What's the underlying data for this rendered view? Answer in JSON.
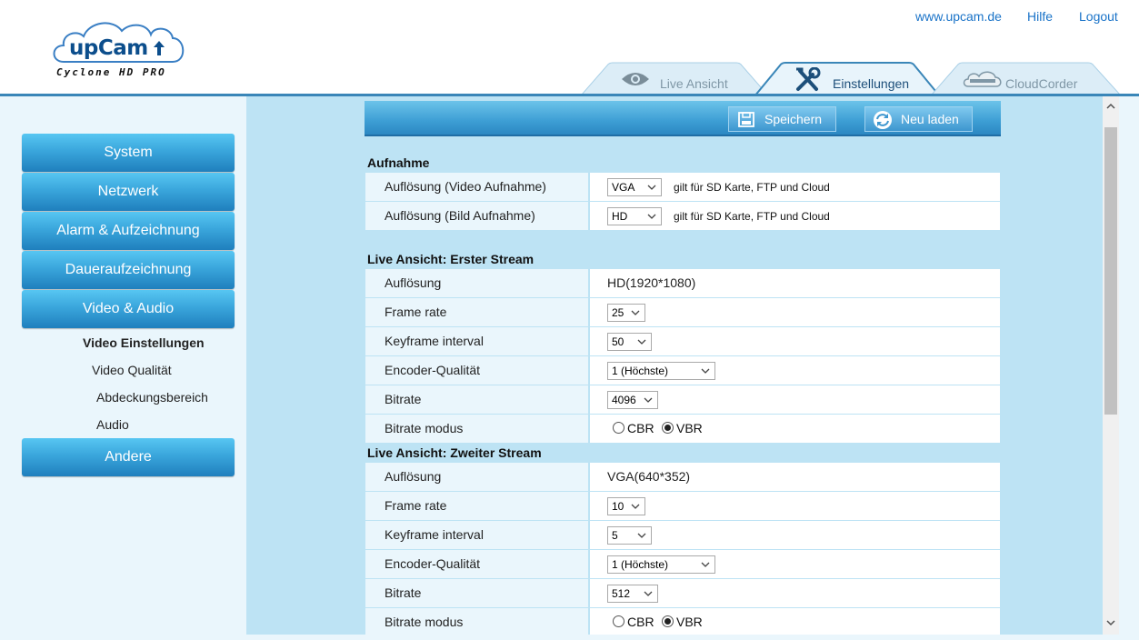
{
  "brand": {
    "logo_word": "upCam",
    "logo_sub": "Cyclone HD PRO",
    "colors": {
      "header_line": "#3a86b8",
      "menu_blue": "#2f94d0",
      "main_bg": "#bde3f4",
      "sidebar_bg": "#eaf6fc",
      "link": "#1a73c8"
    }
  },
  "top_links": {
    "website": "www.upcam.de",
    "help": "Hilfe",
    "logout": "Logout"
  },
  "tabs": [
    {
      "label": "Live Ansicht",
      "icon": "eye-icon",
      "active": false
    },
    {
      "label": "Einstellungen",
      "icon": "tools-icon",
      "active": true
    },
    {
      "label": "CloudCorder",
      "icon": "cloudcorder-icon",
      "active": false
    }
  ],
  "sidebar": {
    "menu": [
      "System",
      "Netzwerk",
      "Alarm & Aufzeichnung",
      "Daueraufzeichnung",
      "Video & Audio"
    ],
    "submenu": [
      {
        "label": "Video Einstellungen",
        "active": true
      },
      {
        "label": "Video Qualität",
        "active": false
      },
      {
        "label": "Abdeckungsbereich",
        "active": false
      },
      {
        "label": "Audio",
        "active": false
      }
    ],
    "other": "Andere"
  },
  "toolbar": {
    "save_label": "Speichern",
    "reload_label": "Neu laden"
  },
  "sections": {
    "recording": {
      "title": "Aufnahme",
      "rows": [
        {
          "label": "Auflösung (Video Aufnahme)",
          "value": "VGA",
          "note": "gilt für SD Karte, FTP und Cloud"
        },
        {
          "label": "Auflösung (Bild Aufnahme)",
          "value": "HD",
          "note": "gilt für SD Karte, FTP und Cloud"
        }
      ]
    },
    "stream1": {
      "title": "Live Ansicht: Erster Stream",
      "resolution_label": "Auflösung",
      "resolution_value": "HD(1920*1080)",
      "framerate_label": "Frame rate",
      "framerate_value": "25",
      "keyframe_label": "Keyframe interval",
      "keyframe_value": "50",
      "quality_label": "Encoder-Qualität",
      "quality_value": "1 (Höchste)",
      "bitrate_label": "Bitrate",
      "bitrate_value": "4096",
      "mode_label": "Bitrate modus",
      "mode_cbr": "CBR",
      "mode_vbr": "VBR",
      "mode_selected": "VBR"
    },
    "stream2": {
      "title": "Live Ansicht: Zweiter Stream",
      "resolution_label": "Auflösung",
      "resolution_value": "VGA(640*352)",
      "framerate_label": "Frame rate",
      "framerate_value": "10",
      "keyframe_label": "Keyframe interval",
      "keyframe_value": "5",
      "quality_label": "Encoder-Qualität",
      "quality_value": "1 (Höchste)",
      "bitrate_label": "Bitrate",
      "bitrate_value": "512",
      "mode_label": "Bitrate modus",
      "mode_cbr": "CBR",
      "mode_vbr": "VBR",
      "mode_selected": "VBR"
    }
  }
}
